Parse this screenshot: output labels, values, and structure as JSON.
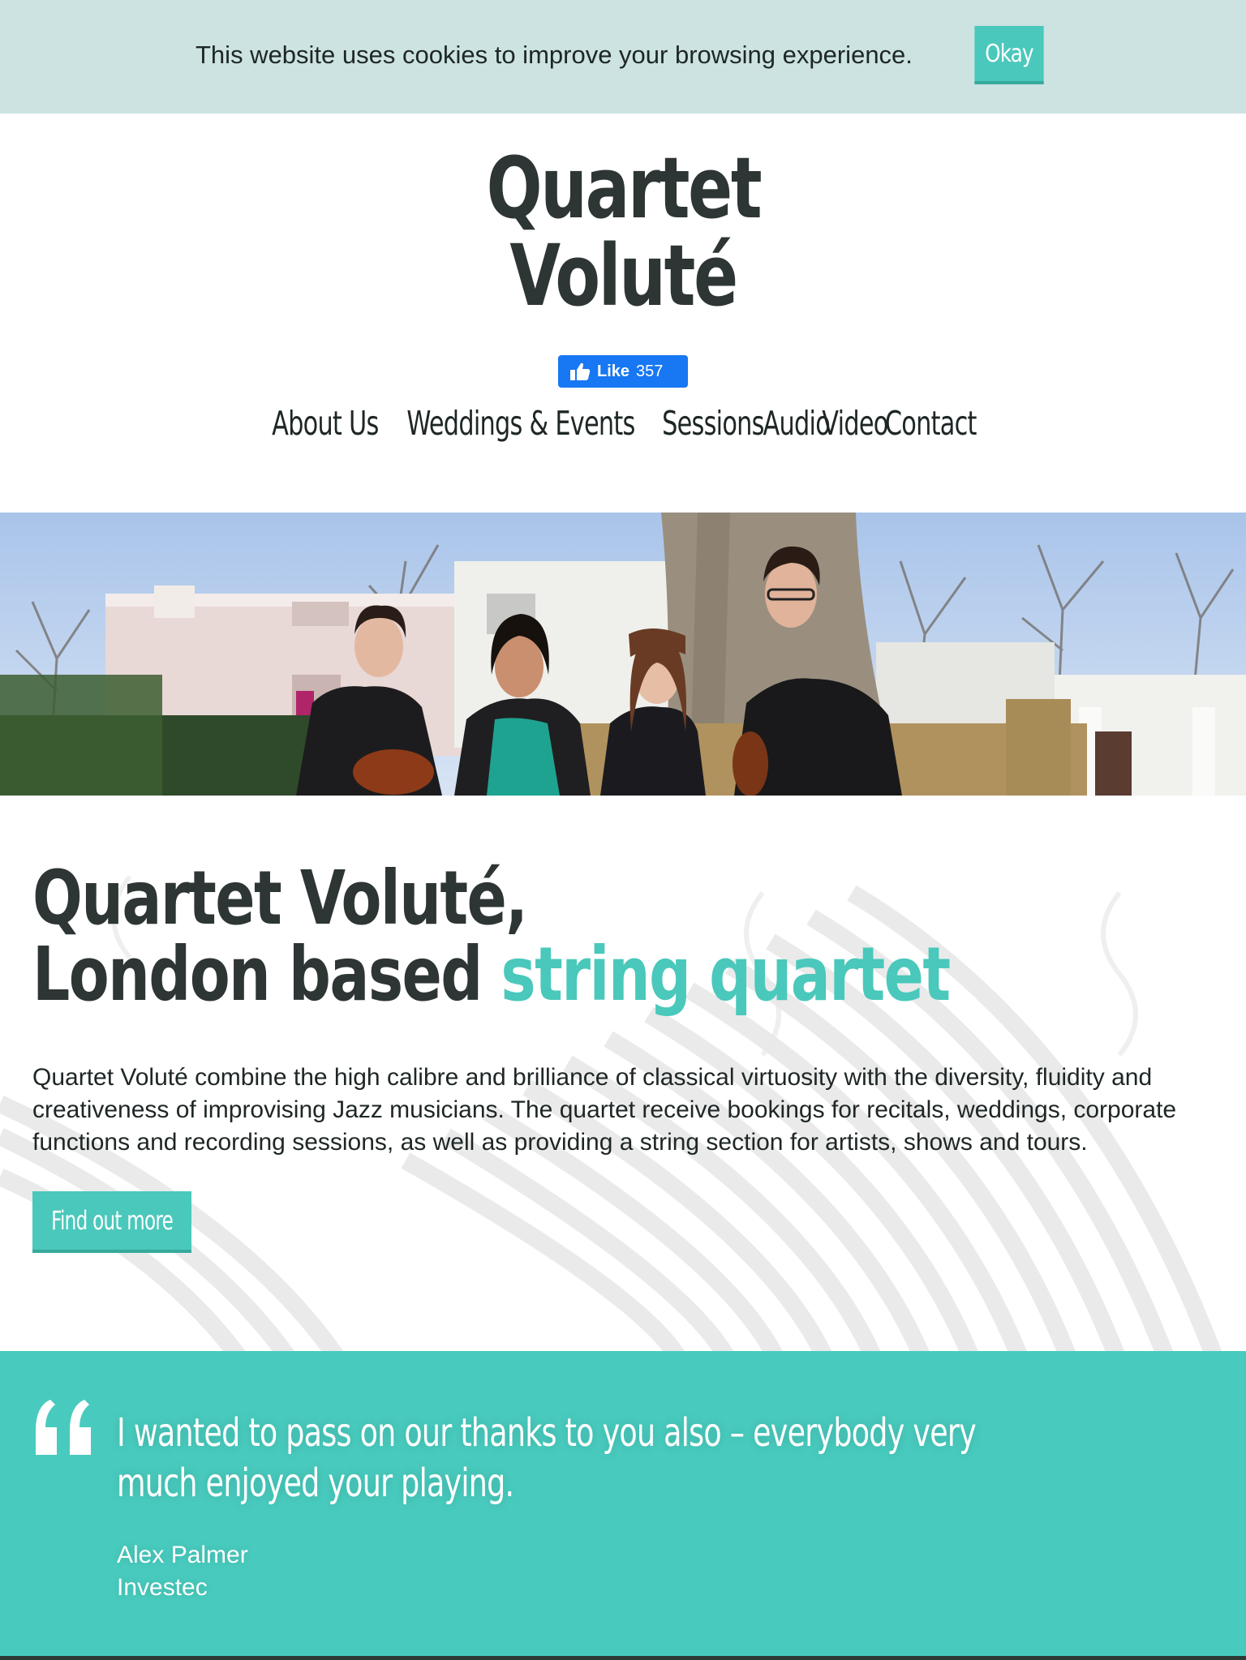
{
  "cookie_bar": {
    "message": "This website uses cookies to improve your browsing experience.",
    "okay_label": "Okay"
  },
  "site": {
    "title_line1": "Quartet",
    "title_line2": "Voluté"
  },
  "facebook": {
    "like_label": "Like",
    "like_count": "357"
  },
  "nav": {
    "items": [
      {
        "label": "About Us"
      },
      {
        "label": "Weddings & Events"
      },
      {
        "label": "Sessions"
      },
      {
        "label": "Audio"
      },
      {
        "label": "Video"
      },
      {
        "label": "Contact"
      }
    ]
  },
  "intro": {
    "headline_line1": "Quartet Voluté,",
    "headline_line2_plain": "London based ",
    "headline_line2_accent": "string quartet",
    "paragraph": "Quartet Voluté combine the high calibre and brilliance of classical virtuosity with the diversity, fluidity and creativeness of improvising Jazz musicians. The quartet receive bookings for recitals, weddings, corporate functions and recording sessions, as well as providing a string section for artists, shows and tours.",
    "cta_label": "Find out more"
  },
  "testimonial": {
    "quote": "I wanted to pass on our thanks to you also – everybody very much enjoyed your playing.",
    "author_name": "Alex Palmer",
    "author_company": "Investec"
  },
  "colors": {
    "accent": "#4ac8bb",
    "cookie_bg": "#cce3e1",
    "heading": "#2e3535",
    "facebook_blue": "#1877f2"
  },
  "icons": {
    "facebook_like": "thumbs-up-icon",
    "quote": "quote-mark-icon"
  }
}
